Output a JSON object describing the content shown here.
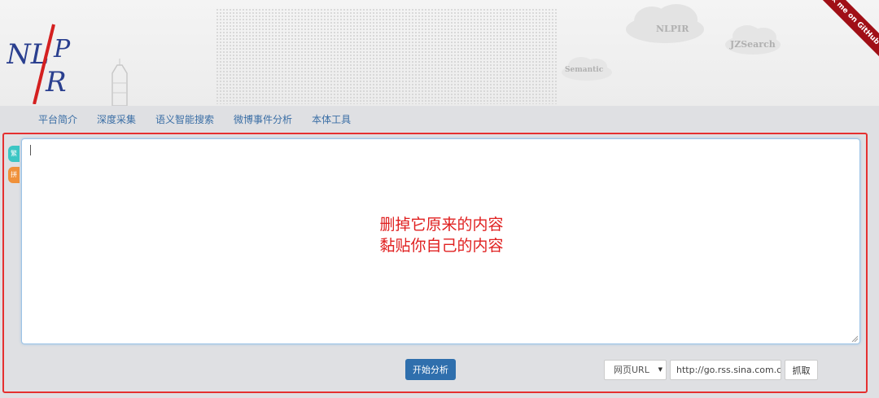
{
  "header": {
    "logo_text": "NLPIR",
    "clouds": [
      "NLPIR",
      "JZSearch",
      "Semantic"
    ],
    "ribbon": "Fork me on GitHub"
  },
  "nav": {
    "items": [
      {
        "label": "平台简介"
      },
      {
        "label": "深度采集"
      },
      {
        "label": "语义智能搜索"
      },
      {
        "label": "微博事件分析"
      },
      {
        "label": "本体工具"
      }
    ]
  },
  "side_tabs": [
    {
      "label": "繁",
      "color": "#3cc6c4"
    },
    {
      "label": "拼",
      "color": "#f0913a"
    }
  ],
  "editor": {
    "annotation_line1": "删掉它原来的内容",
    "annotation_line2": "黏贴你自己的内容"
  },
  "controls": {
    "analyze_label": "开始分析",
    "source_select": "网页URL",
    "url_value": "http://go.rss.sina.com.c",
    "fetch_label": "抓取"
  },
  "colors": {
    "accent": "#2f6fad",
    "nav_text": "#3a6ea5",
    "annotation": "#e02020",
    "outline": "#e53030",
    "ribbon": "#a00f16"
  }
}
